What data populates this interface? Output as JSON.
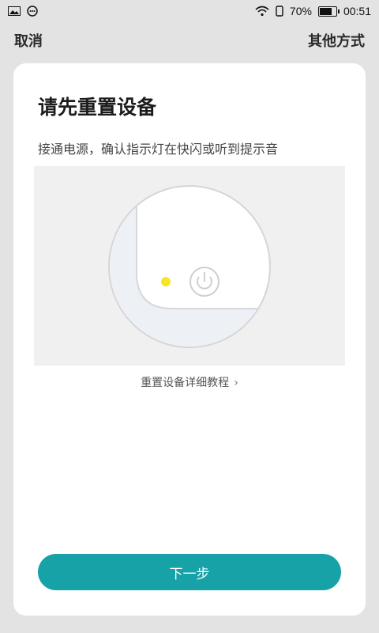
{
  "status_bar": {
    "battery_percent": "70%",
    "time": "00:51"
  },
  "top_bar": {
    "cancel_label": "取消",
    "other_methods_label": "其他方式"
  },
  "card": {
    "title": "请先重置设备",
    "subtitle": "接通电源，确认指示灯在快闪或听到提示音",
    "tutorial_link": "重置设备详细教程",
    "next_button": "下一步"
  },
  "colors": {
    "accent": "#17a2a8",
    "indicator_light": "#f7e52a"
  },
  "icons": {
    "status_left": [
      "image-icon",
      "chat-icon"
    ],
    "status_right": [
      "wifi-icon",
      "phone-icon",
      "battery-icon"
    ],
    "illustration": [
      "power-icon"
    ]
  }
}
